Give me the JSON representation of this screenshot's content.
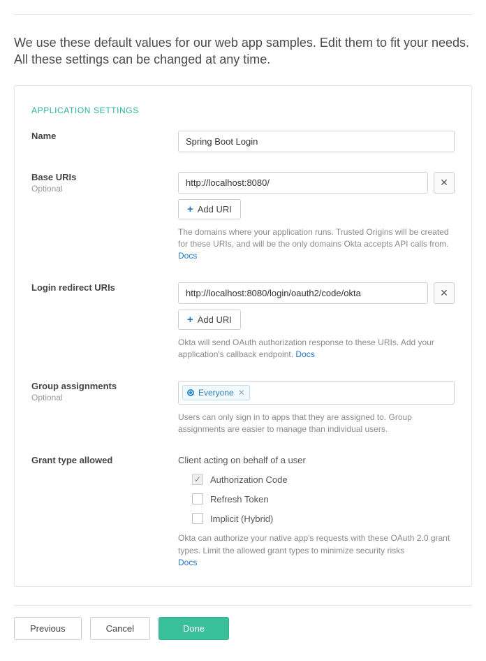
{
  "intro": "We use these default values for our web app samples. Edit them to fit your needs. All these settings can be changed at any time.",
  "section_title": "APPLICATION SETTINGS",
  "fields": {
    "name": {
      "label": "Name",
      "value": "Spring Boot Login"
    },
    "base_uris": {
      "label": "Base URIs",
      "optional": "Optional",
      "value": "http://localhost:8080/",
      "add_label": "Add URI",
      "help_prefix": "The domains where your application runs. Trusted Origins will be created for these URIs, and will be the only domains Okta accepts API calls from. ",
      "help_link": "Docs"
    },
    "login_redirect": {
      "label": "Login redirect URIs",
      "value": "http://localhost:8080/login/oauth2/code/okta",
      "add_label": "Add URI",
      "help_prefix": "Okta will send OAuth authorization response to these URIs. Add your application's callback endpoint. ",
      "help_link": "Docs"
    },
    "group": {
      "label": "Group assignments",
      "optional": "Optional",
      "chip": "Everyone",
      "help": "Users can only sign in to apps that they are assigned to. Group assignments are easier to manage than individual users."
    },
    "grant": {
      "label": "Grant type allowed",
      "subhead": "Client acting on behalf of a user",
      "options": {
        "auth_code": "Authorization Code",
        "refresh": "Refresh Token",
        "implicit": "Implicit (Hybrid)"
      },
      "help_prefix": "Okta can authorize your native app's requests with these OAuth 2.0 grant types. Limit the allowed grant types to minimize security risks ",
      "help_link": "Docs"
    }
  },
  "footer": {
    "previous": "Previous",
    "cancel": "Cancel",
    "done": "Done"
  }
}
